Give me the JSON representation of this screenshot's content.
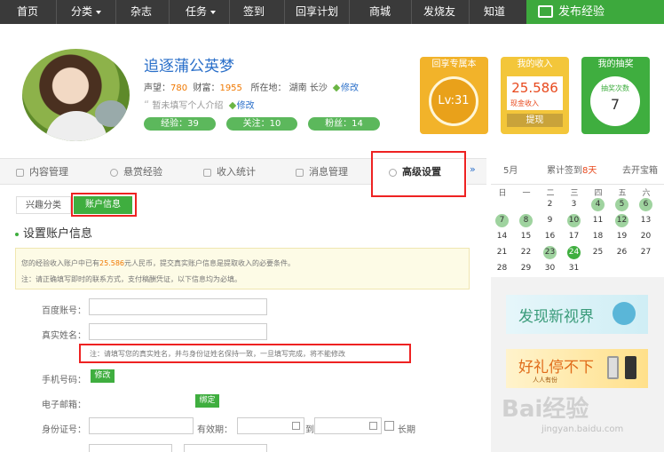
{
  "nav": {
    "items": [
      "首页",
      "分类",
      "杂志",
      "任务",
      "签到",
      "回享计划",
      "商城",
      "发烧友",
      "知道"
    ],
    "publish": "发布经验"
  },
  "profile": {
    "name": "追逐蒲公英梦",
    "reputation_label": "声望：",
    "reputation": "780",
    "wealth_label": "财富：",
    "wealth": "1955",
    "location_label": "所在地：",
    "location": "湖南 长沙",
    "edit": "修改",
    "intro": "暂未填写个人介绍",
    "exp": "经验：39",
    "follow": "关注：10",
    "fans": "粉丝：14"
  },
  "cards": {
    "vip_title": "回享专属本",
    "level": "Lv:31",
    "income_title": "我的收入",
    "income": "25.586",
    "income_sub": "现金收入",
    "withdraw": "提现",
    "draw_title": "我的抽奖",
    "draw_label": "抽奖次数",
    "draw_count": "7"
  },
  "tabs": [
    "内容管理",
    "悬赏经验",
    "收入统计",
    "消息管理",
    "高级设置"
  ],
  "tab_more": "»",
  "subtabs": [
    "兴趣分类",
    "账户信息"
  ],
  "section_title": "设置账户信息",
  "notice": {
    "line1_a": "您的经验收入账户中已有",
    "line1_amt": "25.586",
    "line1_b": "元人民币，提交真实账户信息是提取收入的必要条件。",
    "line2": "注：请正确填写即时的联系方式，支付稿酬凭证，以下信息均为必填。"
  },
  "form": {
    "baidu_account": "百度账号：",
    "real_name": "真实姓名：",
    "name_note": "注：请填写您的真实姓名，并与身份证姓名保持一致，一旦填写完成，将不能修改",
    "phone": "手机号码：",
    "modify": "修改",
    "email": "电子邮箱：",
    "bind": "绑定",
    "id_number": "身份证号：",
    "valid": "有效期：",
    "to": "到",
    "long_term": "长期"
  },
  "calendar": {
    "month": "5月",
    "signed_label": "累计签到",
    "signed_days": "8天",
    "open_box": "去开宝箱",
    "weekdays": [
      "日",
      "一",
      "二",
      "三",
      "四",
      "五",
      "六"
    ],
    "weeks": [
      [
        "",
        "",
        "",
        "",
        "",
        "",
        ""
      ],
      [
        "",
        "",
        "2",
        "3",
        "4",
        "5",
        "6"
      ],
      [
        "7",
        "8",
        "9",
        "10",
        "11",
        "12",
        "13"
      ],
      [
        "14",
        "15",
        "16",
        "17",
        "18",
        "19",
        "20"
      ],
      [
        "21",
        "22",
        "23",
        "24",
        "25",
        "26",
        "27"
      ],
      [
        "28",
        "29",
        "30",
        "31",
        "",
        "",
        ""
      ]
    ],
    "signed_dates": [
      "4",
      "5",
      "6",
      "7",
      "8",
      "10",
      "12",
      "23"
    ],
    "today": "24"
  },
  "banners": {
    "b1": "发现新视界",
    "b2": "好礼停不下",
    "b2_sub": "人人有份"
  },
  "watermark": "Bai经验",
  "watermark_url": "jingyan.baidu.com",
  "colors": {
    "green": "#3fae3f",
    "nav": "#3a3a3a",
    "red_highlight": "#e22222",
    "orange": "#f07800"
  }
}
